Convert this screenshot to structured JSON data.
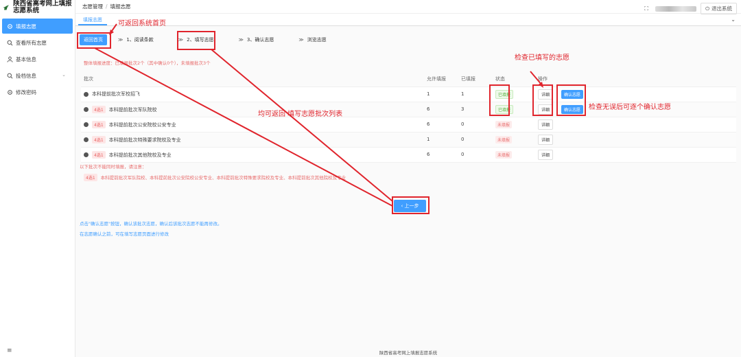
{
  "sidebar": {
    "title": "陕西省高考网上填报志愿系统",
    "items": [
      {
        "label": "填报志愿",
        "icon": "gear-icon",
        "active": true
      },
      {
        "label": "查看所有志愿",
        "icon": "search-icon"
      },
      {
        "label": "基本信息",
        "icon": "user-icon"
      },
      {
        "label": "投档信息",
        "icon": "search-icon",
        "has_arrow": true
      },
      {
        "label": "修改密码",
        "icon": "gear-icon"
      }
    ],
    "collapse_icon": "≡"
  },
  "header": {
    "breadcrumb": [
      "志愿管理",
      "填报志愿"
    ],
    "fullscreen_icon": "⛶",
    "logout_label": "退出系统"
  },
  "tabbar": {
    "active_tab": "填报志愿",
    "caret": "⌄"
  },
  "steps": {
    "home_label": "返回首页",
    "items": [
      "1、阅读条款",
      "2、填写志愿",
      "3、确认志愿",
      "浏览志愿"
    ]
  },
  "progress_text": "整体填报进度：已填报批次2个（其中确认0个），未填报批次3个",
  "table": {
    "headers": [
      "批次",
      "允许填报",
      "已填报",
      "状态",
      "操作"
    ],
    "rows": [
      {
        "tag": "",
        "name": "本科提前批次军校招飞",
        "allowed": "1",
        "filled": "1",
        "status": "已填报",
        "filled_flag": true,
        "detail": "详细",
        "confirm": "确认志愿"
      },
      {
        "tag": "4选1",
        "name": "本科提前批次军队院校",
        "allowed": "6",
        "filled": "3",
        "status": "已填报",
        "filled_flag": true,
        "detail": "详细",
        "confirm": "确认志愿"
      },
      {
        "tag": "4选1",
        "name": "本科提前批次公安院校公安专业",
        "allowed": "6",
        "filled": "0",
        "status": "未填报",
        "filled_flag": false,
        "detail": "详细",
        "confirm": ""
      },
      {
        "tag": "4选1",
        "name": "本科提前批次特殊要求院校及专业",
        "allowed": "1",
        "filled": "0",
        "status": "未填报",
        "filled_flag": false,
        "detail": "详细",
        "confirm": ""
      },
      {
        "tag": "4选1",
        "name": "本科提前批次其他院校及专业",
        "allowed": "6",
        "filled": "0",
        "status": "未填报",
        "filled_flag": false,
        "detail": "详细",
        "confirm": ""
      }
    ]
  },
  "notes": {
    "head": "以下批次不能同时填报，请注意：",
    "tag": "4选1",
    "line": "本科提前批次军队院校、本科提前批次公安院校公安专业、本科提前批次特殊要求院校及专业、本科提前批次其他院校及专业"
  },
  "prev_button": "‹ 上一步",
  "tips": [
    "点击\"确认志愿\"按钮，确认该批次志愿，确认后该批次志愿不能再修改。",
    "在志愿确认之前，可在填写志愿页面进行修改"
  ],
  "footer": "陕西省高考网上填报志愿系统",
  "annotations": {
    "color": "#e0242c",
    "home": "可返回系统首页",
    "check": "检查已填写的志愿",
    "confirm": "检查无误后可逐个确认志愿",
    "back": "均可返回    填写志愿批次列表"
  }
}
